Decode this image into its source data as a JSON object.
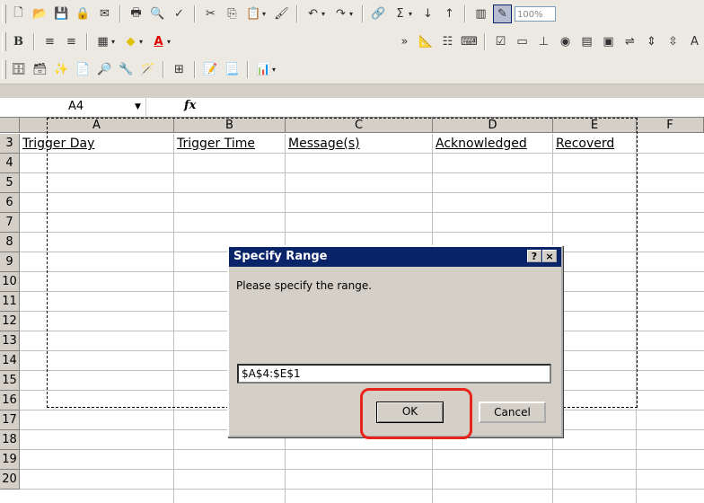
{
  "toolbar": {
    "zoom": "100%"
  },
  "formula_bar": {
    "name_box": "A4",
    "fx_label": "fx"
  },
  "grid": {
    "columns": [
      "A",
      "B",
      "C",
      "D",
      "E",
      "F"
    ],
    "rows": [
      "3",
      "4",
      "5",
      "6",
      "7",
      "8",
      "9",
      "10",
      "11",
      "12",
      "13",
      "14",
      "15",
      "16",
      "17",
      "18",
      "19",
      "20"
    ],
    "row3": [
      "Trigger Day",
      "Trigger Time",
      "Message(s)",
      "Acknowledged",
      "Recoverd"
    ]
  },
  "dialog": {
    "title": "Specify Range",
    "help_label": "?",
    "close_label": "×",
    "prompt": "Please specify the range.",
    "range_value": "$A$4:$E$1",
    "ok_label": "OK",
    "cancel_label": "Cancel"
  },
  "colors": {
    "title_bar": "#0a246a",
    "highlight": "#e8231a"
  }
}
